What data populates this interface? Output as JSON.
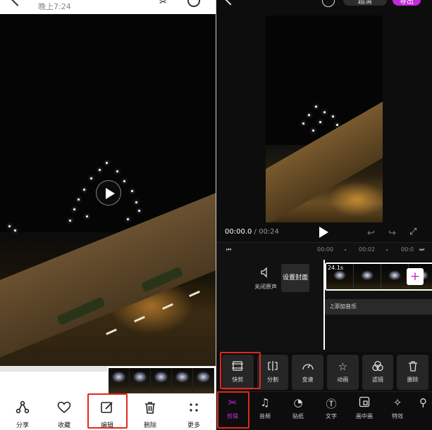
{
  "left": {
    "status_time": "晚上7:24",
    "toolbar": [
      {
        "label": "分享",
        "icon": "share-icon"
      },
      {
        "label": "收藏",
        "icon": "heart-icon"
      },
      {
        "label": "编辑",
        "icon": "edit-icon"
      },
      {
        "label": "删除",
        "icon": "trash-icon"
      },
      {
        "label": "更多",
        "icon": "more-icon"
      }
    ]
  },
  "right": {
    "top": {
      "resolution": "超清",
      "export": "导出"
    },
    "timecode": {
      "current": "00:00.0",
      "separator": " / ",
      "total": "00:24"
    },
    "ruler": {
      "t0": "00:00",
      "t1": "00:02",
      "t2": "00:0"
    },
    "timeline": {
      "mute_label": "关闭原声",
      "cover_label": "设置封面",
      "clip_duration": "24.1s",
      "music_label": "添加音乐"
    },
    "subtools": [
      {
        "label": "快剪",
        "icon": "quick-cut-icon"
      },
      {
        "label": "分割",
        "icon": "split-icon"
      },
      {
        "label": "变速",
        "icon": "speed-icon"
      },
      {
        "label": "动画",
        "icon": "animation-icon"
      },
      {
        "label": "滤镜",
        "icon": "filter-icon"
      },
      {
        "label": "删除",
        "icon": "trash-icon"
      }
    ],
    "maintools": [
      {
        "label": "剪辑",
        "icon": "scissors-icon",
        "active": true
      },
      {
        "label": "音频",
        "icon": "music-icon"
      },
      {
        "label": "贴纸",
        "icon": "sticker-icon"
      },
      {
        "label": "文字",
        "icon": "text-icon"
      },
      {
        "label": "画中画",
        "icon": "pip-icon"
      },
      {
        "label": "特效",
        "icon": "effects-icon"
      }
    ]
  },
  "colors": {
    "accent": "#c12bd9",
    "highlight_box": "#e0281e",
    "editor_bg": "#0d0d0d"
  }
}
